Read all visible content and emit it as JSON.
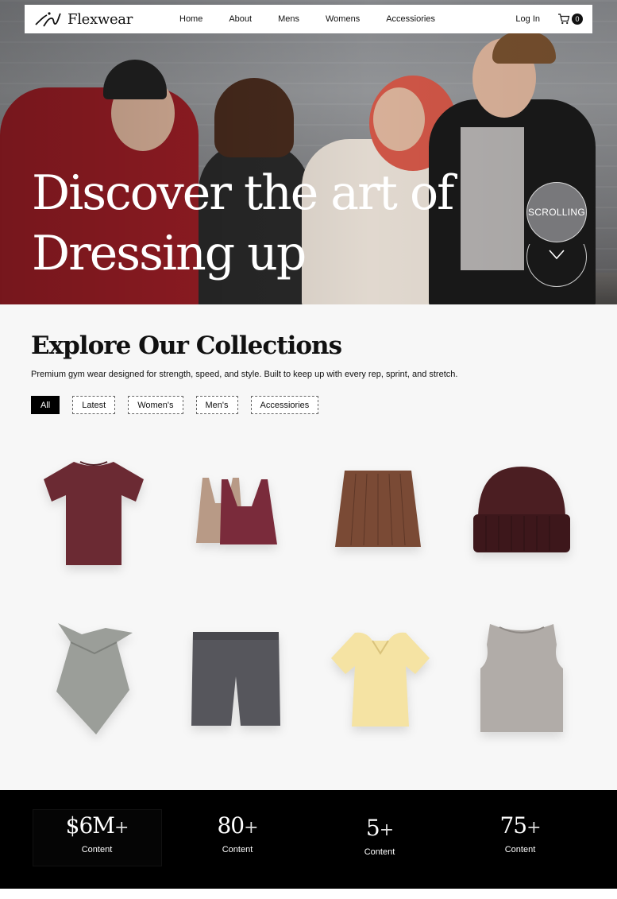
{
  "nav": {
    "brand": "Flexwear",
    "links": [
      "Home",
      "About",
      "Mens",
      "Womens",
      "Accessiories"
    ],
    "login": "Log In",
    "cart_count": "0"
  },
  "hero": {
    "title_line1": "Discover the art of",
    "title_line2": "Dressing up",
    "scroll_label": "SCROLLING"
  },
  "collections": {
    "title": "Explore Our Collections",
    "subtitle": "Premium gym wear designed for strength, speed, and style. Built to keep up with every rep, sprint, and stretch.",
    "filters": [
      "All",
      "Latest",
      "Women's",
      "Men's",
      "Accessiories"
    ],
    "active_filter": "All",
    "products": [
      "maroon-tshirt",
      "sports-bras",
      "brown-skirt",
      "maroon-beanie",
      "grey-scarf",
      "grey-shorts",
      "yellow-blouse",
      "grey-tank-top"
    ]
  },
  "stats": [
    {
      "value": "$6M",
      "suffix": "+",
      "label": "Content"
    },
    {
      "value": "80",
      "suffix": "+",
      "label": "Content"
    },
    {
      "value": "5",
      "suffix": "+",
      "label": "Content"
    },
    {
      "value": "75",
      "suffix": "+",
      "label": "Content"
    }
  ],
  "colors": {
    "maroon": "#6b2a33",
    "brown": "#7a4a35",
    "black": "#000000",
    "background": "#f7f7f7"
  }
}
